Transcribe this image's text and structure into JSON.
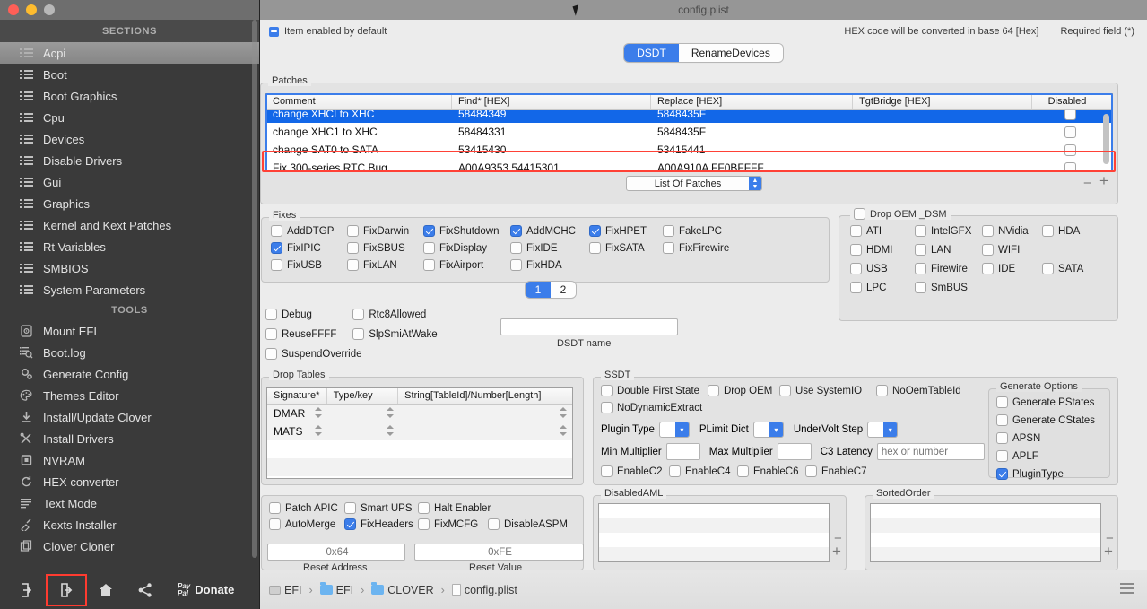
{
  "window": {
    "title": "config.plist",
    "traffic_lights": [
      "close",
      "minimize",
      "zoom"
    ]
  },
  "sidebar": {
    "sections_header": "SECTIONS",
    "tools_header": "TOOLS",
    "sections": [
      {
        "label": "Acpi",
        "icon": "list-icon",
        "selected": true
      },
      {
        "label": "Boot",
        "icon": "list-icon",
        "selected": false
      },
      {
        "label": "Boot Graphics",
        "icon": "list-icon",
        "selected": false
      },
      {
        "label": "Cpu",
        "icon": "list-icon",
        "selected": false
      },
      {
        "label": "Devices",
        "icon": "list-icon",
        "selected": false
      },
      {
        "label": "Disable Drivers",
        "icon": "list-icon",
        "selected": false
      },
      {
        "label": "Gui",
        "icon": "list-icon",
        "selected": false
      },
      {
        "label": "Graphics",
        "icon": "list-icon",
        "selected": false
      },
      {
        "label": "Kernel and Kext Patches",
        "icon": "list-icon",
        "selected": false
      },
      {
        "label": "Rt Variables",
        "icon": "list-icon",
        "selected": false
      },
      {
        "label": "SMBIOS",
        "icon": "list-icon",
        "selected": false
      },
      {
        "label": "System Parameters",
        "icon": "list-icon",
        "selected": false
      }
    ],
    "tools": [
      {
        "label": "Mount EFI",
        "icon": "disk-icon"
      },
      {
        "label": "Boot.log",
        "icon": "log-search-icon"
      },
      {
        "label": "Generate Config",
        "icon": "gears-icon"
      },
      {
        "label": "Themes Editor",
        "icon": "palette-icon"
      },
      {
        "label": "Install/Update Clover",
        "icon": "download-icon"
      },
      {
        "label": "Install Drivers",
        "icon": "tools-icon"
      },
      {
        "label": "NVRAM",
        "icon": "chip-icon"
      },
      {
        "label": "HEX converter",
        "icon": "refresh-icon"
      },
      {
        "label": "Text Mode",
        "icon": "text-lines-icon"
      },
      {
        "label": "Kexts Installer",
        "icon": "plug-icon"
      },
      {
        "label": "Clover Cloner",
        "icon": "copy-icon"
      }
    ],
    "toolbar": {
      "import_label": "import-icon",
      "export_label": "export-icon",
      "home_label": "home-icon",
      "share_label": "share-icon",
      "paypal_line1": "Pay",
      "paypal_line2": "Pal",
      "donate_label": "Donate"
    }
  },
  "infobar": {
    "default_note": "Item enabled by default",
    "hex_note": "HEX code will be converted in base 64 [Hex]",
    "required_note": "Required field (*)"
  },
  "tabs": [
    {
      "label": "DSDT",
      "active": true
    },
    {
      "label": "RenameDevices",
      "active": false
    }
  ],
  "patches": {
    "title": "Patches",
    "columns": [
      "Comment",
      "Find* [HEX]",
      "Replace [HEX]",
      "TgtBridge [HEX]",
      "Disabled"
    ],
    "rows": [
      {
        "comment": "change XHCI to XHC",
        "find": "58484349",
        "replace": "5848435F",
        "tgtbridge": "",
        "disabled": false,
        "selected": true
      },
      {
        "comment": "change XHC1 to XHC",
        "find": "58484331",
        "replace": "5848435F",
        "tgtbridge": "",
        "disabled": false,
        "selected": false
      },
      {
        "comment": "change SAT0 to SATA",
        "find": "53415430",
        "replace": "53415441",
        "tgtbridge": "",
        "disabled": false,
        "selected": false
      },
      {
        "comment": "Fix 300-series RTC Bug",
        "find": "A00A9353 54415301",
        "replace": "A00A910A FF0BFFFF",
        "tgtbridge": "",
        "disabled": false,
        "selected": false
      }
    ],
    "list_of_patches_label": "List Of Patches",
    "remove_label": "−",
    "add_label": "+"
  },
  "fixes": {
    "title": "Fixes",
    "items": [
      {
        "label": "AddDTGP",
        "checked": false
      },
      {
        "label": "FixDarwin",
        "checked": false
      },
      {
        "label": "FixShutdown",
        "checked": true
      },
      {
        "label": "AddMCHC",
        "checked": true
      },
      {
        "label": "FixHPET",
        "checked": true
      },
      {
        "label": "FakeLPC",
        "checked": false
      },
      {
        "label": "FixIPIC",
        "checked": true
      },
      {
        "label": "FixSBUS",
        "checked": false
      },
      {
        "label": "FixDisplay",
        "checked": false
      },
      {
        "label": "FixIDE",
        "checked": false
      },
      {
        "label": "FixSATA",
        "checked": false
      },
      {
        "label": "FixFirewire",
        "checked": false
      },
      {
        "label": "FixUSB",
        "checked": false
      },
      {
        "label": "FixLAN",
        "checked": false
      },
      {
        "label": "FixAirport",
        "checked": false
      },
      {
        "label": "FixHDA",
        "checked": false
      }
    ],
    "pager": [
      {
        "label": "1",
        "active": true
      },
      {
        "label": "2",
        "active": false
      }
    ]
  },
  "misc_options": [
    {
      "label": "Debug",
      "checked": false
    },
    {
      "label": "Rtc8Allowed",
      "checked": false
    },
    {
      "label": "ReuseFFFF",
      "checked": false
    },
    {
      "label": "SlpSmiAtWake",
      "checked": false
    },
    {
      "label": "SuspendOverride",
      "checked": false
    }
  ],
  "dsdt_name": {
    "label": "DSDT name",
    "value": "",
    "placeholder": ""
  },
  "drop_oem_dsm": {
    "title": "Drop OEM _DSM",
    "checked": false,
    "items": [
      {
        "label": "ATI",
        "checked": false
      },
      {
        "label": "IntelGFX",
        "checked": false
      },
      {
        "label": "NVidia",
        "checked": false
      },
      {
        "label": "HDA",
        "checked": false
      },
      {
        "label": "HDMI",
        "checked": false
      },
      {
        "label": "LAN",
        "checked": false
      },
      {
        "label": "WIFI",
        "checked": false
      },
      {
        "label": "USB",
        "checked": false
      },
      {
        "label": "Firewire",
        "checked": false
      },
      {
        "label": "IDE",
        "checked": false
      },
      {
        "label": "SATA",
        "checked": false
      },
      {
        "label": "LPC",
        "checked": false
      },
      {
        "label": "SmBUS",
        "checked": false
      }
    ]
  },
  "drop_tables": {
    "title": "Drop Tables",
    "columns": [
      "Signature*",
      "Type/key",
      "String[TableId]/Number[Length]"
    ],
    "rows": [
      {
        "signature": "DMAR",
        "typekey": "",
        "string": ""
      },
      {
        "signature": "MATS",
        "typekey": "",
        "string": ""
      }
    ],
    "remove_label": "−",
    "add_label": "+"
  },
  "ssdt": {
    "title": "SSDT",
    "checks_row1": [
      {
        "label": "Double First State",
        "checked": false
      },
      {
        "label": "Drop OEM",
        "checked": false
      },
      {
        "label": "Use SystemIO",
        "checked": false
      },
      {
        "label": "NoOemTableId",
        "checked": false
      }
    ],
    "checks_row2": [
      {
        "label": "NoDynamicExtract",
        "checked": false
      }
    ],
    "selects": [
      {
        "label": "Plugin Type",
        "value": ""
      },
      {
        "label": "PLimit Dict",
        "value": ""
      },
      {
        "label": "UnderVolt Step",
        "value": ""
      }
    ],
    "fields": [
      {
        "label": "Min Multiplier",
        "value": "",
        "placeholder": ""
      },
      {
        "label": "Max Multiplier",
        "value": "",
        "placeholder": ""
      },
      {
        "label": "C3 Latency",
        "value": "",
        "placeholder": "hex or number"
      }
    ],
    "cstates": [
      {
        "label": "EnableC2",
        "checked": false
      },
      {
        "label": "EnableC4",
        "checked": false
      },
      {
        "label": "EnableC6",
        "checked": false
      },
      {
        "label": "EnableC7",
        "checked": false
      }
    ]
  },
  "generate_options": {
    "title": "Generate Options",
    "items": [
      {
        "label": "Generate PStates",
        "checked": false
      },
      {
        "label": "Generate CStates",
        "checked": false
      },
      {
        "label": "APSN",
        "checked": false
      },
      {
        "label": "APLF",
        "checked": false
      },
      {
        "label": "PluginType",
        "checked": true
      }
    ]
  },
  "apic_group": {
    "row1": [
      {
        "label": "Patch APIC",
        "checked": false
      },
      {
        "label": "Smart UPS",
        "checked": false
      },
      {
        "label": "Halt Enabler",
        "checked": false
      }
    ],
    "row2": [
      {
        "label": "AutoMerge",
        "checked": false
      },
      {
        "label": "FixHeaders",
        "checked": true
      },
      {
        "label": "FixMCFG",
        "checked": false
      },
      {
        "label": "DisableASPM",
        "checked": false
      }
    ],
    "reset_address": {
      "label": "Reset Address",
      "value": "",
      "placeholder": "0x64"
    },
    "reset_value": {
      "label": "Reset Value",
      "value": "",
      "placeholder": "0xFE"
    }
  },
  "disabled_aml": {
    "title": "DisabledAML",
    "rows": [
      "",
      "",
      "",
      ""
    ],
    "remove_label": "−",
    "add_label": "+"
  },
  "sorted_order": {
    "title": "SortedOrder",
    "rows": [
      "",
      "",
      "",
      ""
    ],
    "remove_label": "−",
    "add_label": "+"
  },
  "pathbar": {
    "crumbs": [
      {
        "label": "EFI",
        "icon": "disk-icon"
      },
      {
        "label": "EFI",
        "icon": "folder-icon"
      },
      {
        "label": "CLOVER",
        "icon": "folder-icon"
      },
      {
        "label": "config.plist",
        "icon": "document-icon"
      }
    ],
    "separator": "›",
    "menu_label": "hamburger-icon"
  },
  "colors": {
    "accent": "#3b7dea",
    "selection": "#1267e8",
    "highlight_rect": "#ff4136",
    "sidebar_bg": "#3a3a3a",
    "panel_bg": "#ececec"
  }
}
